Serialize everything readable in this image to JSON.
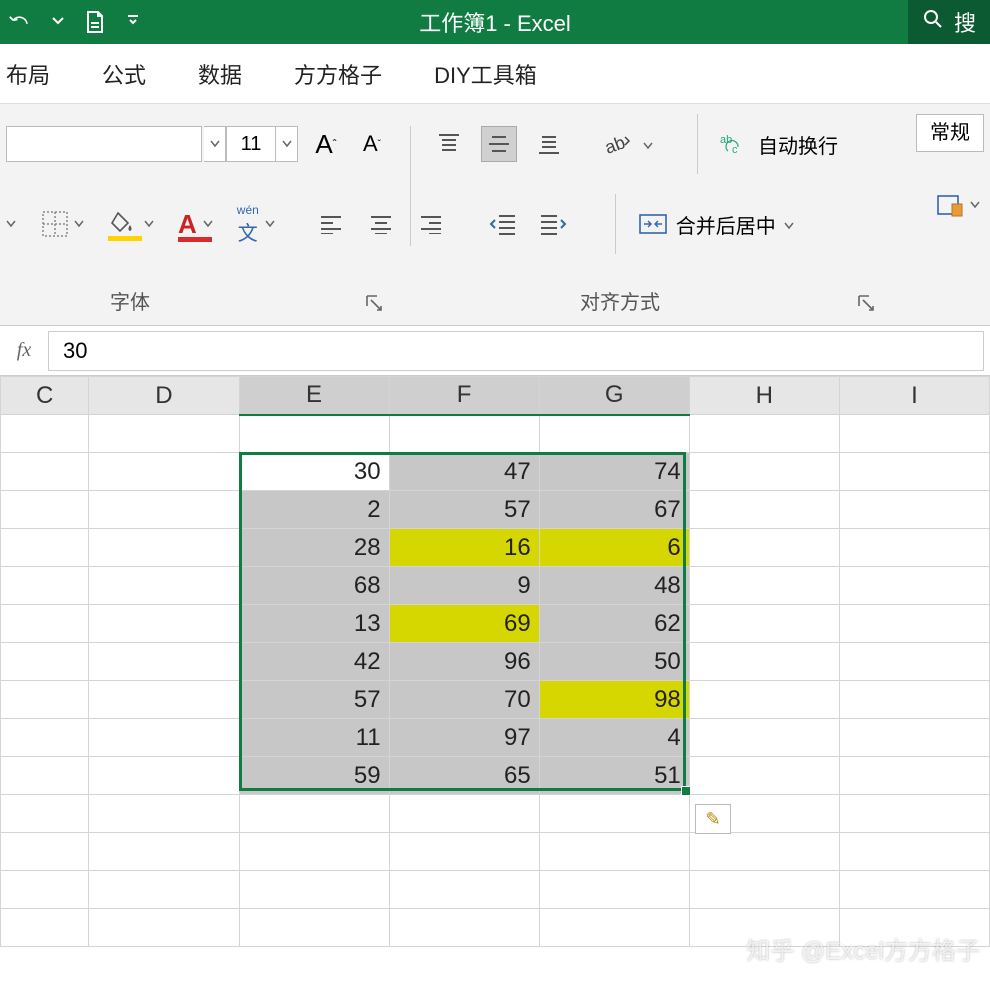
{
  "title": "工作簿1  -  Excel",
  "search_label": "搜",
  "ribbon_tabs": [
    "布局",
    "公式",
    "数据",
    "方方格子",
    "DIY工具箱"
  ],
  "font": {
    "size": "11"
  },
  "alignment": {
    "wrap_label": "自动换行",
    "merge_label": "合并后居中"
  },
  "numberfmt": {
    "general": "常规"
  },
  "sections": {
    "font": "字体",
    "align": "对齐方式"
  },
  "formula_bar": {
    "fx": "fx",
    "value": "30"
  },
  "columns": [
    "C",
    "D",
    "E",
    "F",
    "G",
    "H",
    "I"
  ],
  "selected_columns": [
    "E",
    "F",
    "G"
  ],
  "active_cell": {
    "col": "E",
    "row": 0
  },
  "data_rows": [
    {
      "E": {
        "v": "30"
      },
      "F": {
        "v": "47"
      },
      "G": {
        "v": "74"
      }
    },
    {
      "E": {
        "v": "2"
      },
      "F": {
        "v": "57"
      },
      "G": {
        "v": "67"
      }
    },
    {
      "E": {
        "v": "28"
      },
      "F": {
        "v": "16",
        "hl": true
      },
      "G": {
        "v": "6",
        "hl": true
      }
    },
    {
      "E": {
        "v": "68"
      },
      "F": {
        "v": "9"
      },
      "G": {
        "v": "48"
      }
    },
    {
      "E": {
        "v": "13"
      },
      "F": {
        "v": "69",
        "hl": true
      },
      "G": {
        "v": "62"
      }
    },
    {
      "E": {
        "v": "42"
      },
      "F": {
        "v": "96"
      },
      "G": {
        "v": "50"
      }
    },
    {
      "E": {
        "v": "57"
      },
      "F": {
        "v": "70"
      },
      "G": {
        "v": "98",
        "hl": true
      }
    },
    {
      "E": {
        "v": "11"
      },
      "F": {
        "v": "97"
      },
      "G": {
        "v": "4"
      }
    },
    {
      "E": {
        "v": "59"
      },
      "F": {
        "v": "65"
      },
      "G": {
        "v": "51"
      }
    }
  ],
  "trailing_rows": 4,
  "watermark": "知乎 @Excel方方格子",
  "chart_data": {
    "type": "table",
    "title": "Selected range E:G",
    "columns": [
      "E",
      "F",
      "G"
    ],
    "rows": [
      [
        30,
        47,
        74
      ],
      [
        2,
        57,
        67
      ],
      [
        28,
        16,
        6
      ],
      [
        68,
        9,
        48
      ],
      [
        13,
        69,
        62
      ],
      [
        42,
        96,
        50
      ],
      [
        57,
        70,
        98
      ],
      [
        11,
        97,
        4
      ],
      [
        59,
        65,
        51
      ]
    ]
  }
}
